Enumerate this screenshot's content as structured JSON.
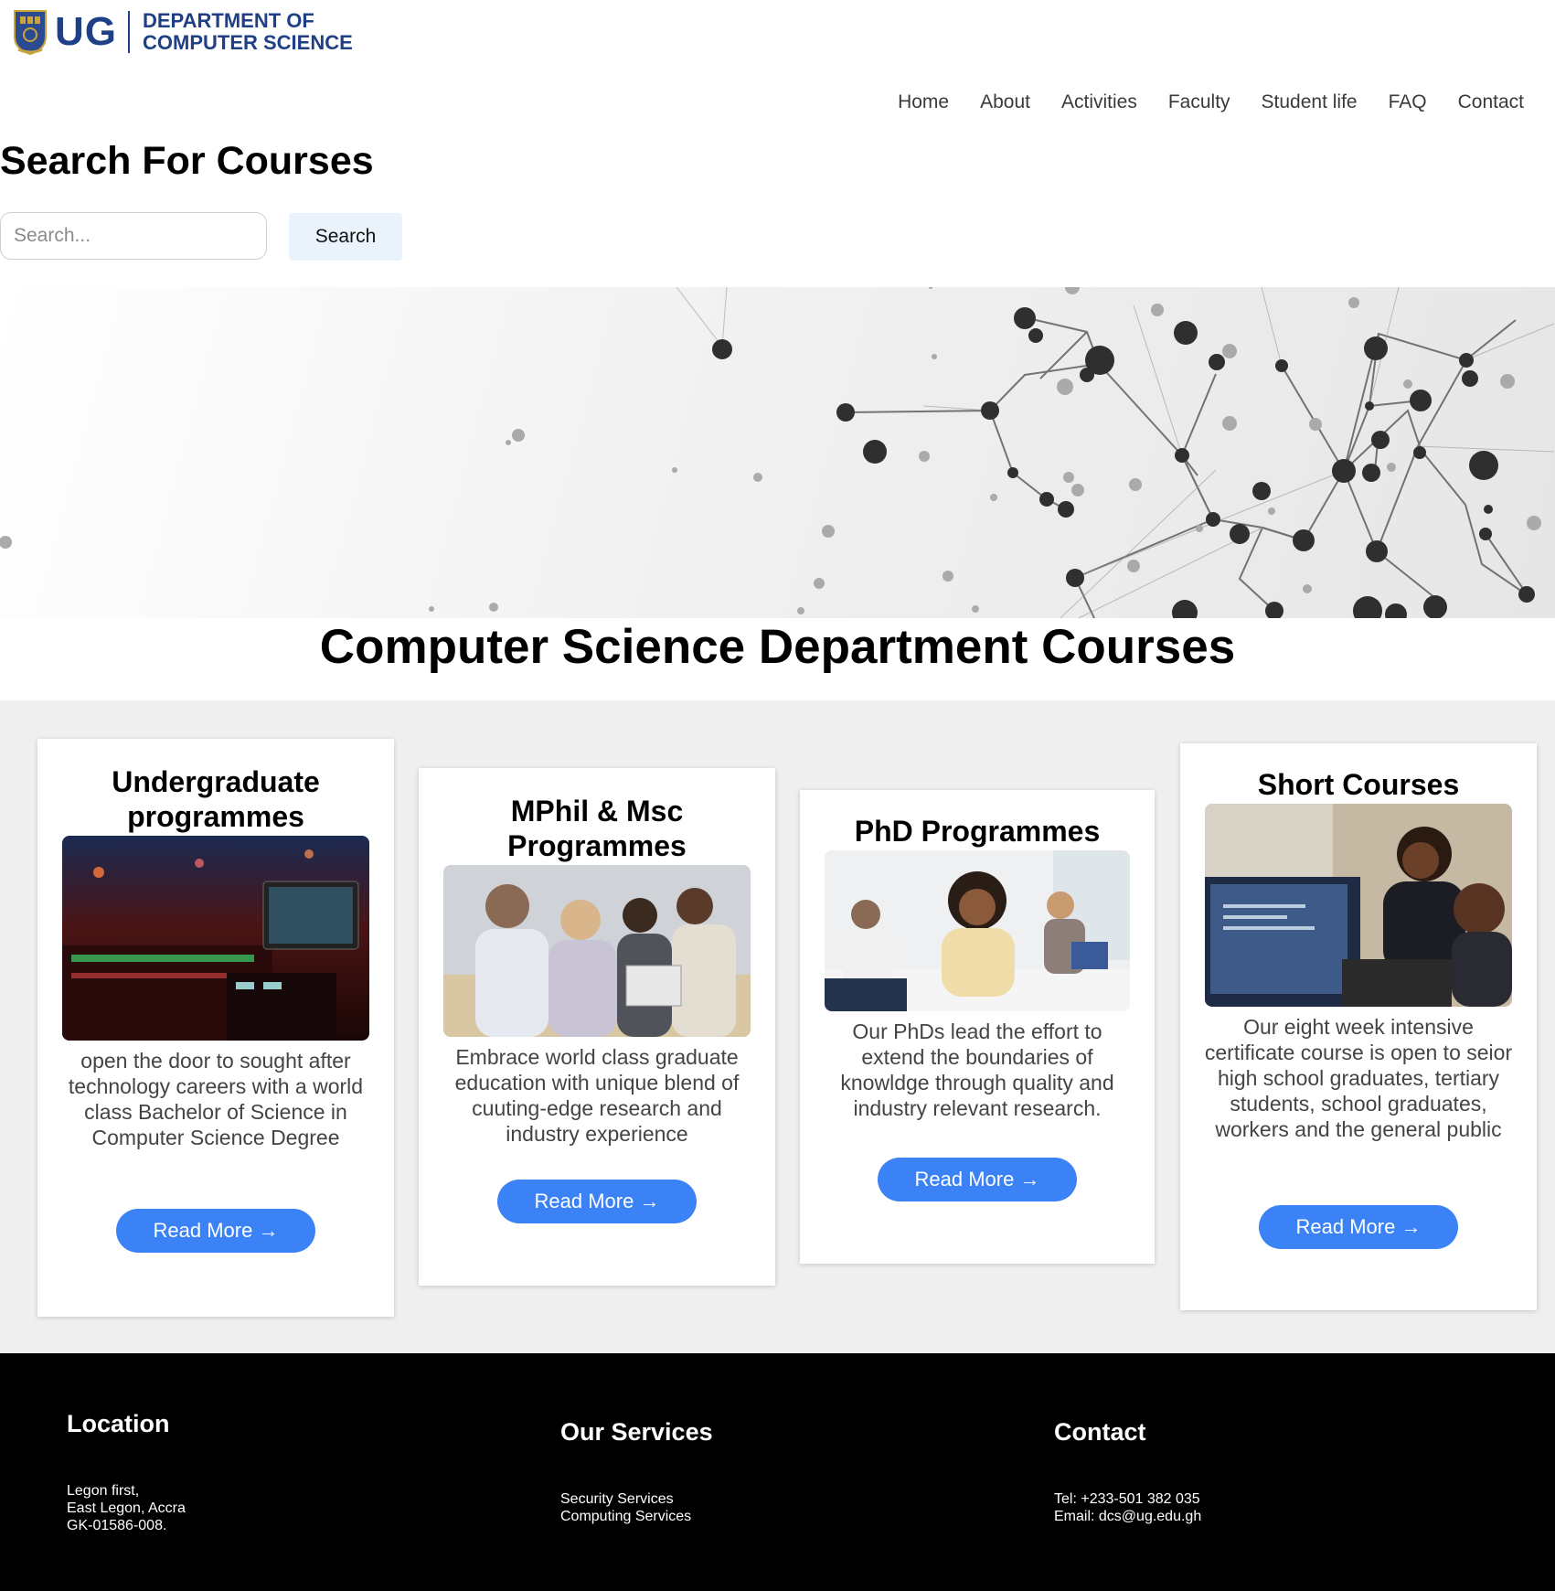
{
  "header": {
    "logo_ug": "UG",
    "logo_line1": "DEPARTMENT OF",
    "logo_line2": "COMPUTER SCIENCE",
    "nav": [
      "Home",
      "About",
      "Activities",
      "Faculty",
      "Student life",
      "FAQ",
      "Contact"
    ]
  },
  "search": {
    "title": "Search For Courses",
    "placeholder": "Search...",
    "button_label": "Search"
  },
  "courses_heading": "Computer Science Department Courses",
  "cards": [
    {
      "title": "Undergraduate programmes",
      "image": "audio-mixing-console-photo",
      "description": "open the door to sought after technology careers with a world class Bachelor of Science in Computer Science Degree",
      "button": "Read More →"
    },
    {
      "title": "MPhil & Msc Programmes",
      "image": "students-with-laptops-photo",
      "description": "Embrace world class graduate education with unique blend of cuuting-edge research and industry experience",
      "button": "Read More →"
    },
    {
      "title": "PhD Programmes",
      "image": "smiling-student-classroom-photo",
      "description": "Our PhDs lead the effort to extend the boundaries of knowldge through quality and industry relevant research.",
      "button": "Read More →"
    },
    {
      "title": "Short Courses",
      "image": "students-coding-together-photo",
      "description": "Our eight week intensive certificate course is open to seior high school graduates, tertiary students, school graduates, workers and the general public",
      "button": "Read More →"
    }
  ],
  "footer": {
    "location": {
      "title": "Location",
      "lines": [
        "Legon first,",
        "East Legon, Accra",
        "GK-01586-008."
      ]
    },
    "services": {
      "title": "Our Services",
      "lines": [
        "Security Services",
        "Computing Services"
      ]
    },
    "contact": {
      "title": "Contact",
      "lines": [
        "Tel: +233-501 382 035",
        "Email: dcs@ug.edu.gh"
      ]
    }
  },
  "colors": {
    "brand_blue": "#1f3f86",
    "button_blue": "#3b82f6",
    "search_button_bg": "#eaf3fb",
    "section_bg": "#efefef",
    "footer_bg": "#000000"
  }
}
